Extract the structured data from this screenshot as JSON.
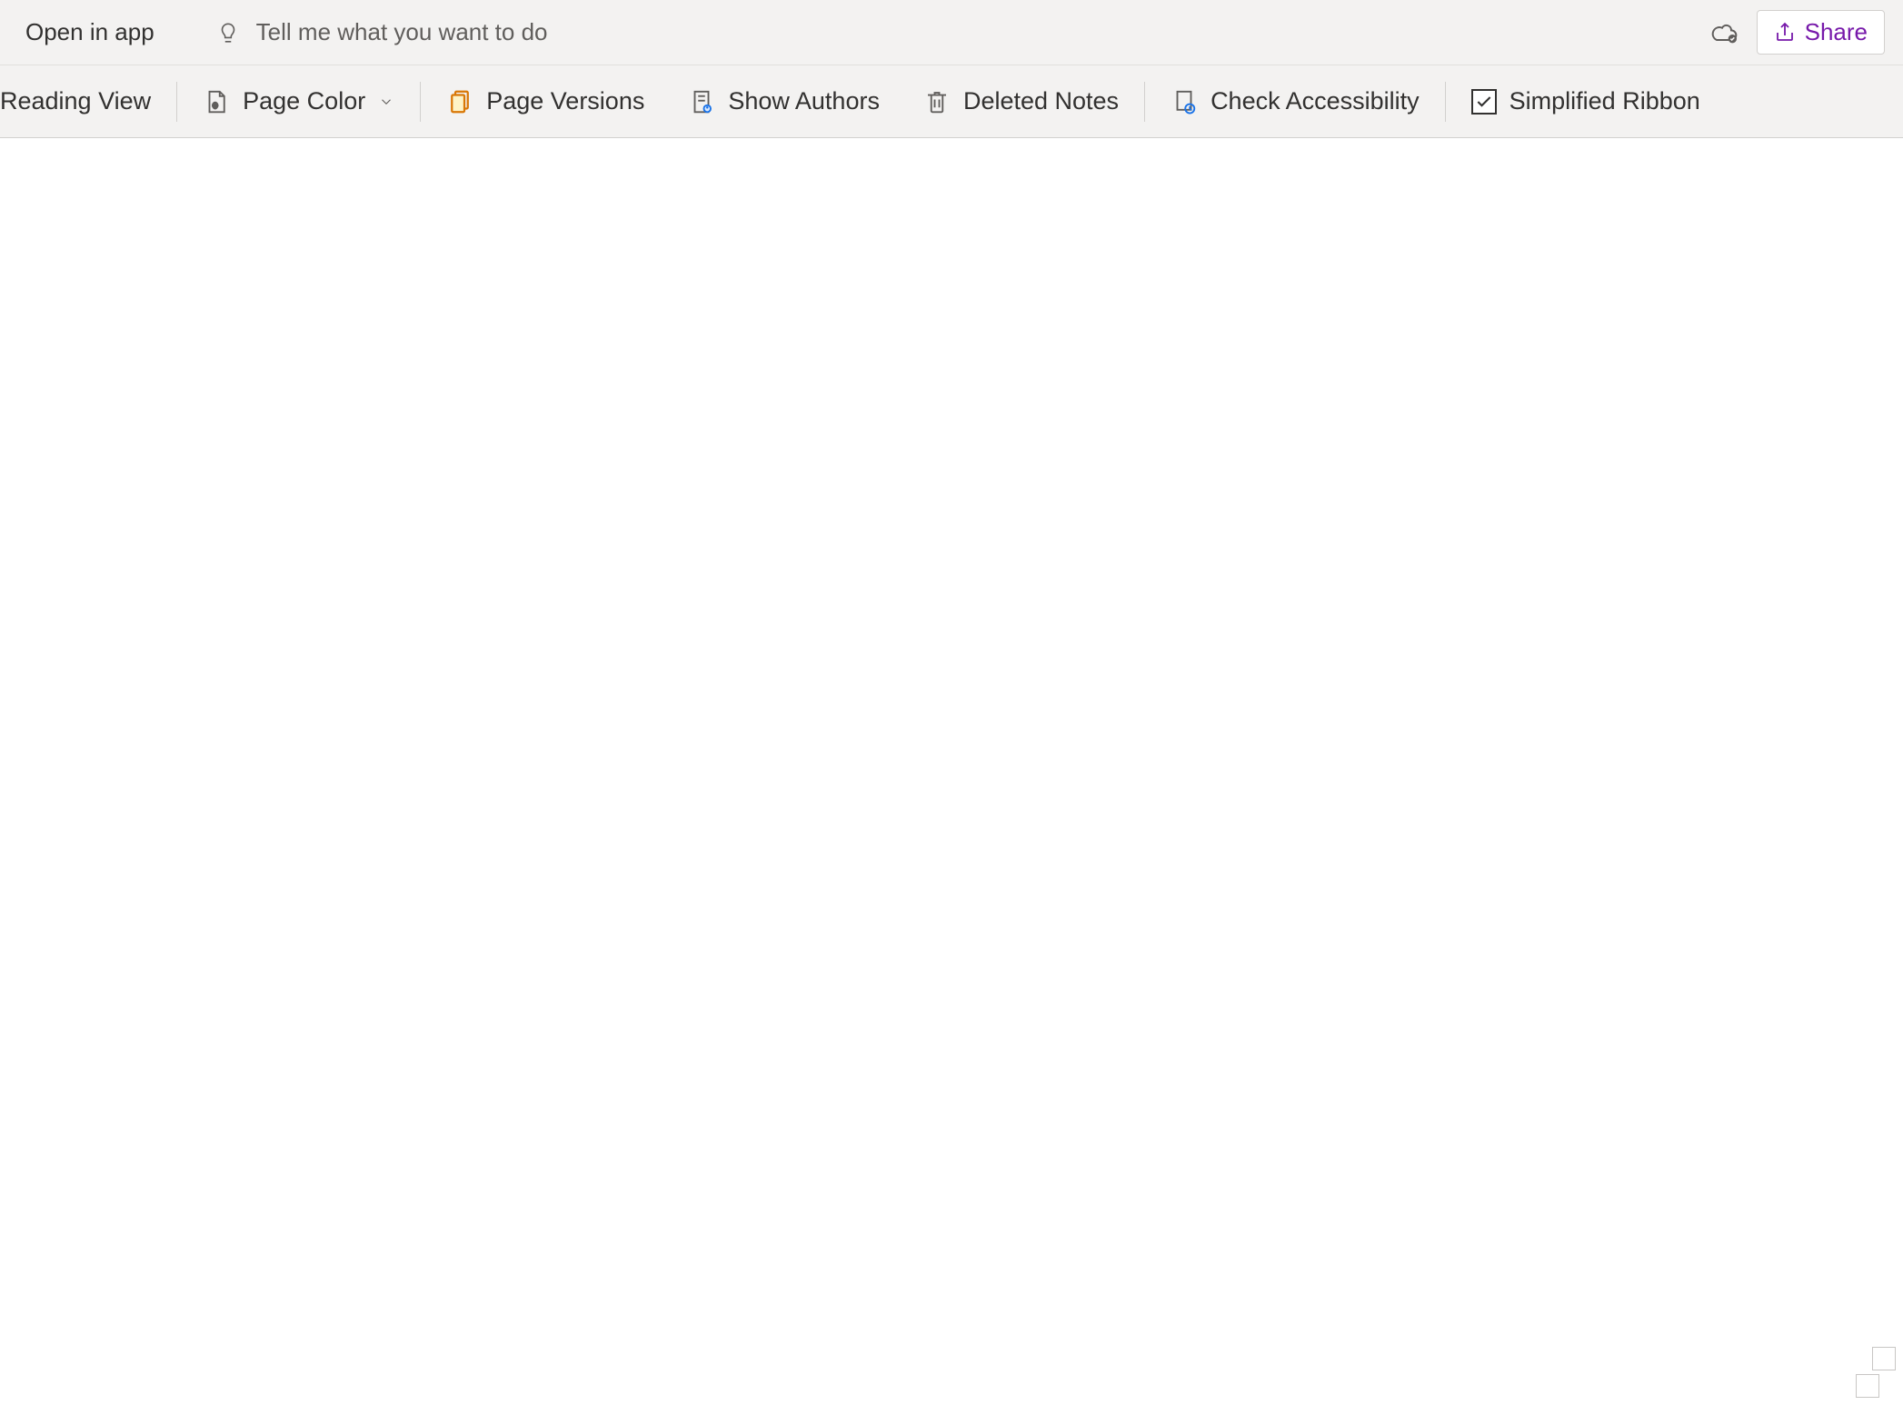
{
  "topbar": {
    "open_in_app": "Open in app",
    "tell_me_placeholder": "Tell me what you want to do",
    "share_label": "Share"
  },
  "ribbon": {
    "reading_view": "Reading View",
    "page_color": "Page Color",
    "page_versions": "Page Versions",
    "show_authors": "Show Authors",
    "deleted_notes": "Deleted Notes",
    "check_accessibility": "Check Accessibility",
    "simplified_ribbon": "Simplified Ribbon"
  }
}
